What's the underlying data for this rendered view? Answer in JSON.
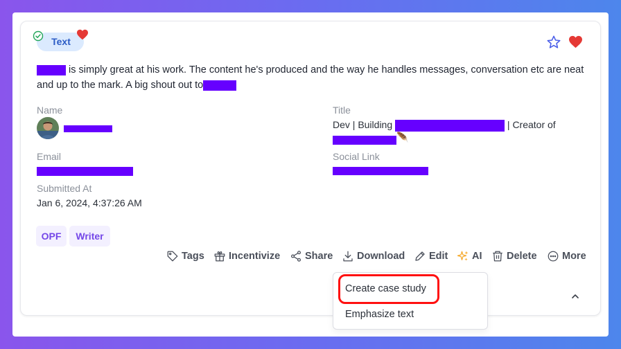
{
  "card": {
    "type_badge": "Text",
    "review_text_1": "is simply great at his work. The content he's produced and the way he handles messages, conversation etc are neat and up to the mark. A big shout out to",
    "fields": {
      "name_label": "Name",
      "title_label": "Title",
      "title_prefix": "Dev | Building",
      "title_suffix": "| Creator of",
      "title_emoji": "🪶",
      "email_label": "Email",
      "social_label": "Social Link",
      "submitted_label": "Submitted At",
      "submitted_value": "Jan 6, 2024, 4:37:26 AM"
    },
    "tags": [
      "OPF",
      "Writer"
    ],
    "actions": {
      "tags": "Tags",
      "incentivize": "Incentivize",
      "share": "Share",
      "download": "Download",
      "edit": "Edit",
      "ai": "AI",
      "delete": "Delete",
      "more": "More"
    }
  },
  "dropdown": {
    "items": [
      "Create case study",
      "Emphasize text"
    ]
  },
  "colors": {
    "accent": "#7447e8",
    "redaction": "#6600ff",
    "heart": "#e53935",
    "star": "#4a5ee8",
    "highlight": "#ff1010",
    "badge_bg": "#dbeafe"
  },
  "icons": [
    "check-circle-icon",
    "heart-icon",
    "star-icon",
    "tag-icon",
    "gift-icon",
    "share-icon",
    "download-icon",
    "pencil-icon",
    "sparkles-icon",
    "trash-icon",
    "more-icon",
    "chevron-up-icon"
  ]
}
